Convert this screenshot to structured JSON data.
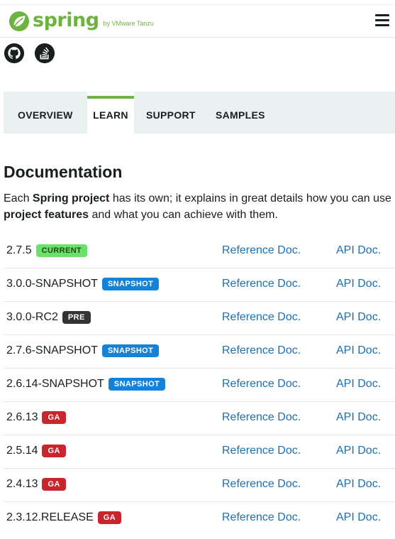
{
  "header": {
    "logo_word": "spring",
    "logo_by": "by VMware Tanzu",
    "brand_color": "#6db33f",
    "menu_icon": "hamburger-icon"
  },
  "social": [
    {
      "icon": "github-icon"
    },
    {
      "icon": "stackoverflow-icon"
    }
  ],
  "tabs": [
    {
      "label": "OVERVIEW",
      "active": false
    },
    {
      "label": "LEARN",
      "active": true
    },
    {
      "label": "SUPPORT",
      "active": false
    },
    {
      "label": "SAMPLES",
      "active": false
    }
  ],
  "documentation": {
    "title": "Documentation",
    "desc_1": "Each ",
    "desc_bold_1": "Spring project",
    "desc_2": " has its own; it explains in great details how you can use ",
    "desc_bold_2": "project features",
    "desc_3": " and what you can achieve with them."
  },
  "releases": [
    {
      "version": "2.7.5",
      "badge": "CURRENT",
      "badge_type": "current",
      "ref": "Reference Doc.",
      "api": "API Doc."
    },
    {
      "version": "3.0.0-SNAPSHOT",
      "badge": "SNAPSHOT",
      "badge_type": "snapshot",
      "ref": "Reference Doc.",
      "api": "API Doc."
    },
    {
      "version": "3.0.0-RC2",
      "badge": "PRE",
      "badge_type": "pre",
      "ref": "Reference Doc.",
      "api": "API Doc."
    },
    {
      "version": "2.7.6-SNAPSHOT",
      "badge": "SNAPSHOT",
      "badge_type": "snapshot",
      "ref": "Reference Doc.",
      "api": "API Doc."
    },
    {
      "version": "2.6.14-SNAPSHOT",
      "badge": "SNAPSHOT",
      "badge_type": "snapshot",
      "ref": "Reference Doc.",
      "api": "API Doc."
    },
    {
      "version": "2.6.13",
      "badge": "GA",
      "badge_type": "ga",
      "ref": "Reference Doc.",
      "api": "API Doc."
    },
    {
      "version": "2.5.14",
      "badge": "GA",
      "badge_type": "ga",
      "ref": "Reference Doc.",
      "api": "API Doc."
    },
    {
      "version": "2.4.13",
      "badge": "GA",
      "badge_type": "ga",
      "ref": "Reference Doc.",
      "api": "API Doc."
    },
    {
      "version": "2.3.12.RELEASE",
      "badge": "GA",
      "badge_type": "ga",
      "ref": "Reference Doc.",
      "api": "API Doc."
    }
  ]
}
